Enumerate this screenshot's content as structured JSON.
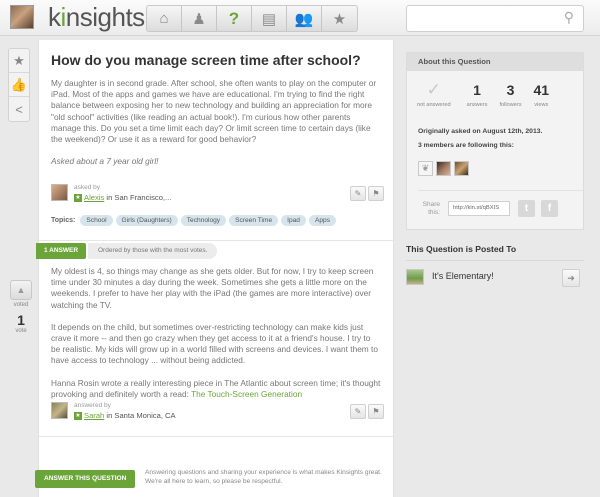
{
  "brand": {
    "logo_pre": "k",
    "logo_i": "i",
    "logo_post": "nsights"
  },
  "nav": {
    "icons": [
      "home-icon",
      "person-icon",
      "question-icon",
      "clipboard-icon",
      "people-icon",
      "star-icon"
    ],
    "glyphs": [
      "⌂",
      "♟",
      "?",
      "▤",
      "👥",
      "★"
    ]
  },
  "search": {
    "placeholder": "",
    "icon": "⚲"
  },
  "rail": {
    "glyphs": [
      "★",
      "👍",
      "<"
    ]
  },
  "vote": {
    "arrow": "▲",
    "label_top": "voted",
    "count": "1",
    "label_bottom": "vote"
  },
  "question": {
    "title": "How do you manage screen time after school?",
    "body_p1": "My daughter is in second grade. After school, she often wants to play on the computer or iPad. Most of the apps and games we have are educational. I'm trying to find the right balance between exposing her to new technology and building an appreciation for more \"old school\" activities (like reading an actual book!). I'm curious how other parents manage this. Do you set a time limit each day? Or limit screen time to certain days (like the weekend)? Or use it as a reward for good behavior?",
    "body_p2": "Asked about a 7 year old girl!",
    "asked_by_label": "asked by",
    "asker_name": "Alexis",
    "asker_location": " in San Francisco,...",
    "topics_label": "Topics:",
    "topics": [
      "School",
      "Girls (Daughters)",
      "Technology",
      "Screen Time",
      "Ipad",
      "Apps"
    ]
  },
  "answers_bar": {
    "count_label": "1 Answer",
    "sort_label": "Ordered by those with the most votes."
  },
  "answer": {
    "p1": "My oldest is 4, so things may change as she gets older. But for now, I try to keep screen time under 30 minutes a day during the week. Sometimes she gets a little more on the weekends. I prefer to have her play with the iPad (the games are more interactive) over watching the TV.",
    "p2": "It depends on the child, but sometimes over-restricting technology can make kids just crave it more -- and then go crazy when they get access to it at a friend's house. I try to be realistic. My kids will grow up in a world filled with screens and devices.  I want them to have access to technology ... without being addicted.",
    "p3_pre": "Hanna Rosin wrote a really interesting piece in The Atlantic about screen time; it's thought provoking and definitely worth a read: ",
    "p3_link": "The Touch-Screen Generation",
    "answered_by_label": "answered by",
    "answerer_name": "Sarah",
    "answerer_location": " in Santa Monica, CA"
  },
  "answer_cta": {
    "button": "Answer This Question",
    "help": "Answering questions and sharing your experience is what makes Kinsights great. We're all here to learn, so please be respectful."
  },
  "about": {
    "title": "About this Question",
    "stats": [
      {
        "value": "✓",
        "label": "not answered"
      },
      {
        "value": "1",
        "label": "answers"
      },
      {
        "value": "3",
        "label": "followers"
      },
      {
        "value": "41",
        "label": "views"
      }
    ],
    "originally_asked": "Originally asked on August 12th, 2013.",
    "following": "3 members are following this:",
    "share_label": "Share this:",
    "share_url": "http://kin.st/qBXIS",
    "twitter": "t",
    "facebook": "f"
  },
  "posted": {
    "title": "This Question is Posted To",
    "group": "It's Elementary!",
    "go": "➜"
  },
  "icons": {
    "comment": "✎",
    "flag": "⚑"
  }
}
